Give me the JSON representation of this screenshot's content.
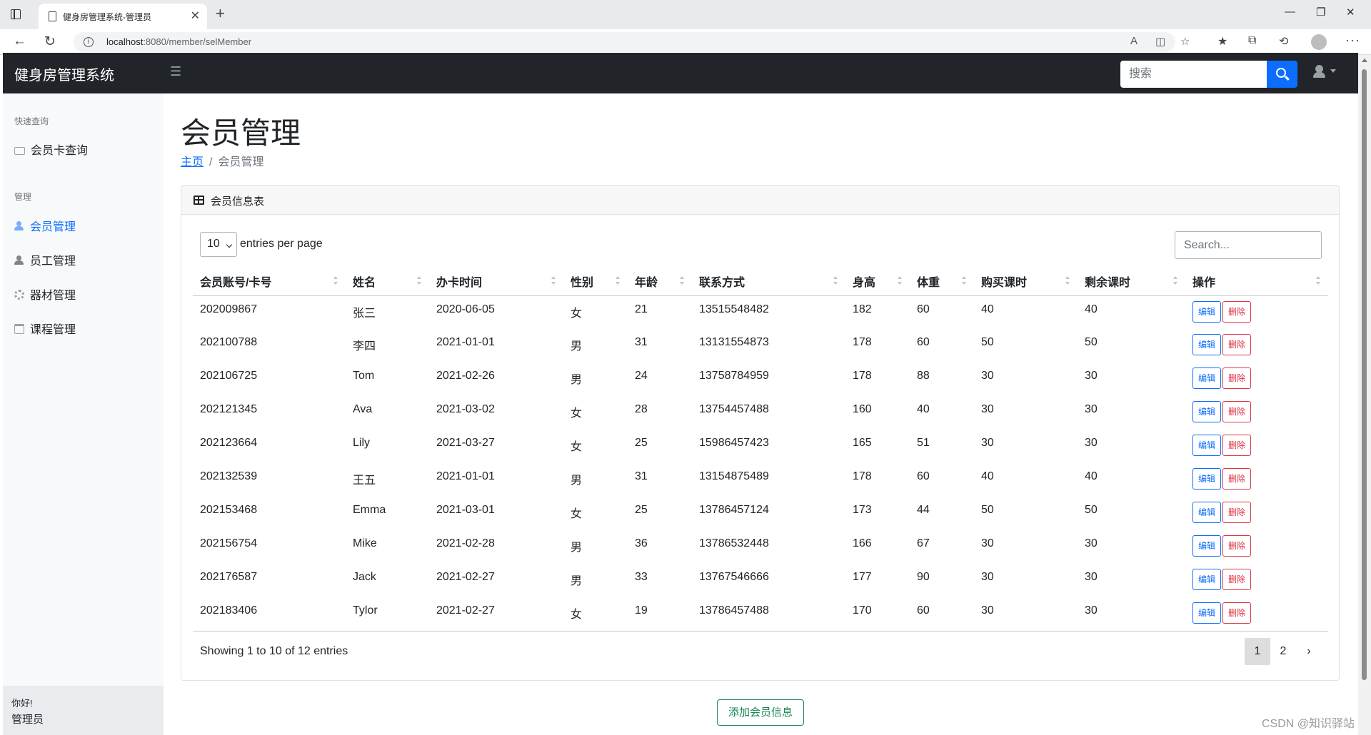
{
  "browser": {
    "tab_title": "健身房管理系统-管理员",
    "url_host": "localhost",
    "url_path": ":8080/member/selMember"
  },
  "navbar": {
    "brand": "健身房管理系统",
    "search_placeholder": "搜索"
  },
  "sidebar": {
    "section_quick": "快速查询",
    "quick_items": [
      {
        "label": "会员卡查询",
        "icon": "card-icon"
      }
    ],
    "section_manage": "管理",
    "manage_items": [
      {
        "label": "会员管理",
        "icon": "user-icon",
        "active": true
      },
      {
        "label": "员工管理",
        "icon": "user-icon"
      },
      {
        "label": "器材管理",
        "icon": "cog-icon"
      },
      {
        "label": "课程管理",
        "icon": "calendar-icon"
      }
    ],
    "footer_greeting": "你好!",
    "footer_role": "管理员"
  },
  "main": {
    "page_title": "会员管理",
    "breadcrumb_home": "主页",
    "breadcrumb_current": "会员管理"
  },
  "card": {
    "title": "会员信息表",
    "per_page_value": "10",
    "per_page_label": "entries per page",
    "search_placeholder": "Search...",
    "columns": [
      "会员账号/卡号",
      "姓名",
      "办卡时间",
      "性别",
      "年龄",
      "联系方式",
      "身高",
      "体重",
      "购买课时",
      "剩余课时",
      "操作"
    ],
    "edit_label": "编辑",
    "delete_label": "删除",
    "rows": [
      [
        "202009867",
        "张三",
        "2020-06-05",
        "女",
        "21",
        "13515548482",
        "182",
        "60",
        "40",
        "40"
      ],
      [
        "202100788",
        "李四",
        "2021-01-01",
        "男",
        "31",
        "13131554873",
        "178",
        "60",
        "50",
        "50"
      ],
      [
        "202106725",
        "Tom",
        "2021-02-26",
        "男",
        "24",
        "13758784959",
        "178",
        "88",
        "30",
        "30"
      ],
      [
        "202121345",
        "Ava",
        "2021-03-02",
        "女",
        "28",
        "13754457488",
        "160",
        "40",
        "30",
        "30"
      ],
      [
        "202123664",
        "Lily",
        "2021-03-27",
        "女",
        "25",
        "15986457423",
        "165",
        "51",
        "30",
        "30"
      ],
      [
        "202132539",
        "王五",
        "2021-01-01",
        "男",
        "31",
        "13154875489",
        "178",
        "60",
        "40",
        "40"
      ],
      [
        "202153468",
        "Emma",
        "2021-03-01",
        "女",
        "25",
        "13786457124",
        "173",
        "44",
        "50",
        "50"
      ],
      [
        "202156754",
        "Mike",
        "2021-02-28",
        "男",
        "36",
        "13786532448",
        "166",
        "67",
        "30",
        "30"
      ],
      [
        "202176587",
        "Jack",
        "2021-02-27",
        "男",
        "33",
        "13767546666",
        "177",
        "90",
        "30",
        "30"
      ],
      [
        "202183406",
        "Tylor",
        "2021-02-27",
        "女",
        "19",
        "13786457488",
        "170",
        "60",
        "30",
        "30"
      ]
    ],
    "info": "Showing 1 to 10 of 12 entries",
    "pages": [
      "1",
      "2"
    ],
    "next": "›"
  },
  "add_button": "添加会员信息",
  "watermark": "CSDN @知识驿站"
}
